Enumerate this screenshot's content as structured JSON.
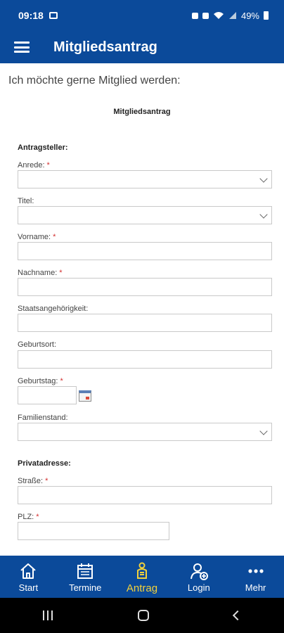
{
  "status": {
    "time": "09:18",
    "battery": "49%"
  },
  "appbar": {
    "title": "Mitgliedsantrag"
  },
  "page": {
    "intro": "Ich möchte gerne Mitglied werden:",
    "form_title": "Mitgliedsantrag",
    "section_applicant": "Antragsteller:",
    "section_address": "Privatadresse:",
    "required_mark": "*",
    "fields": {
      "anrede": "Anrede:",
      "titel": "Titel:",
      "vorname": "Vorname:",
      "nachname": "Nachname:",
      "staatsangehoerigkeit": "Staatsangehörigkeit:",
      "geburtsort": "Geburtsort:",
      "geburtstag": "Geburtstag:",
      "familienstand": "Familienstand:",
      "strasse": "Straße:",
      "plz": "PLZ:"
    }
  },
  "nav": {
    "items": [
      {
        "label": "Start",
        "icon": "home-icon"
      },
      {
        "label": "Termine",
        "icon": "calendar-icon"
      },
      {
        "label": "Antrag",
        "icon": "application-icon",
        "active": true
      },
      {
        "label": "Login",
        "icon": "user-add-icon"
      },
      {
        "label": "Mehr",
        "icon": "more-icon"
      }
    ]
  },
  "colors": {
    "primary": "#0b4a9a",
    "active_nav": "#f2d13b",
    "required": "#d32f2f"
  }
}
